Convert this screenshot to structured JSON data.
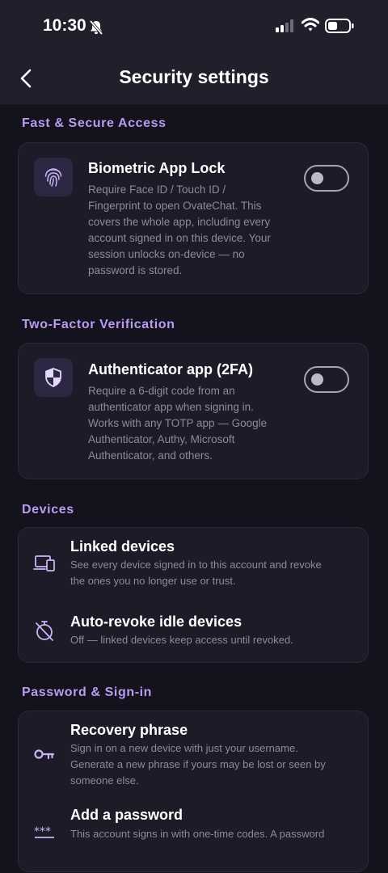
{
  "status_bar": {
    "time": "10:30"
  },
  "header": {
    "title": "Security settings"
  },
  "sections": {
    "fast_access": {
      "title": "Fast & Secure Access",
      "biometric": {
        "title": "Biometric App Lock",
        "desc_lines": [
          "Require Face ID / Touch ID /",
          "Fingerprint to open OvateChat. This",
          "covers the whole app, including every",
          "account signed in on this device. Your",
          "session unlocks on-device — no",
          "password is stored."
        ],
        "enabled": false
      }
    },
    "two_factor": {
      "title": "Two-Factor Verification",
      "authenticator": {
        "title": "Authenticator app (2FA)",
        "desc_lines": [
          "Require a 6-digit code from an",
          "authenticator app when signing in.",
          "Works with any TOTP app — Google",
          "Authenticator, Authy, Microsoft",
          "Authenticator, and others."
        ],
        "enabled": false
      }
    },
    "devices": {
      "title": "Devices",
      "linked": {
        "title": "Linked devices",
        "desc_lines": [
          "See every device signed in to this account and revoke",
          "the ones you no longer use or trust."
        ]
      },
      "auto_revoke": {
        "title": "Auto-revoke idle devices",
        "desc_lines": [
          "Off — linked devices keep access until revoked."
        ]
      }
    },
    "password": {
      "title": "Password & Sign-in",
      "recovery": {
        "title": "Recovery phrase",
        "desc_lines": [
          "Sign in on a new device with just your username.",
          "Generate a new phrase if yours may be lost or seen by",
          "someone else."
        ]
      },
      "add_password": {
        "title": "Add a password",
        "desc_lines": [
          "This account signs in with one-time codes. A password"
        ]
      }
    }
  },
  "colors": {
    "background": "#14121c",
    "card": "#1d1b27",
    "accent": "#b89cf0",
    "muted_text": "#8d8a9a"
  },
  "icons": [
    "bell-slash-icon",
    "signal-icon",
    "wifi-icon",
    "battery-icon",
    "chevron-left-icon",
    "fingerprint-icon",
    "shield-icon",
    "devices-icon",
    "timer-off-icon",
    "key-icon",
    "password-icon"
  ]
}
